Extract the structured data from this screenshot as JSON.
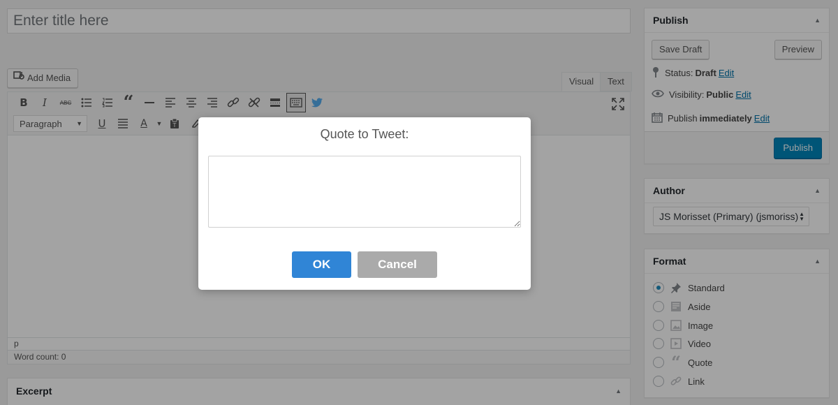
{
  "title_field": {
    "placeholder": "Enter title here"
  },
  "editor": {
    "add_media_label": "Add Media",
    "tabs": {
      "visual": "Visual",
      "text": "Text"
    },
    "format_select": "Paragraph",
    "path": "p",
    "word_count": "Word count: 0",
    "toolbar_row1": [
      "bold",
      "italic",
      "strikethrough",
      "bulleted-list",
      "numbered-list",
      "blockquote",
      "horizontal-line",
      "align-left",
      "align-center",
      "align-right",
      "insert-link",
      "remove-link",
      "read-more",
      "toolbar-toggle",
      "twitter"
    ],
    "toolbar_row2": [
      "underline",
      "justify",
      "text-color",
      "paste-as-text"
    ]
  },
  "excerpt": {
    "title": "Excerpt"
  },
  "publish": {
    "title": "Publish",
    "save_draft": "Save Draft",
    "preview": "Preview",
    "status_label": "Status:",
    "status_value": "Draft",
    "visibility_label": "Visibility:",
    "visibility_value": "Public",
    "publish_label": "Publish",
    "publish_value": "immediately",
    "edit": "Edit",
    "publish_button": "Publish"
  },
  "author": {
    "title": "Author",
    "selected": "JS Morisset (Primary) (jsmoriss)"
  },
  "format": {
    "title": "Format",
    "selected": "Standard",
    "options": [
      "Standard",
      "Aside",
      "Image",
      "Video",
      "Quote",
      "Link"
    ]
  },
  "dialog": {
    "title": "Quote to Tweet:",
    "textarea_value": "",
    "ok": "OK",
    "cancel": "Cancel"
  },
  "colors": {
    "primary_blue": "#0085ba",
    "link_blue": "#0073aa",
    "dialog_ok": "#3085d6",
    "dialog_cancel": "#aaaaaa",
    "twitter_blue": "#1da1f2"
  }
}
